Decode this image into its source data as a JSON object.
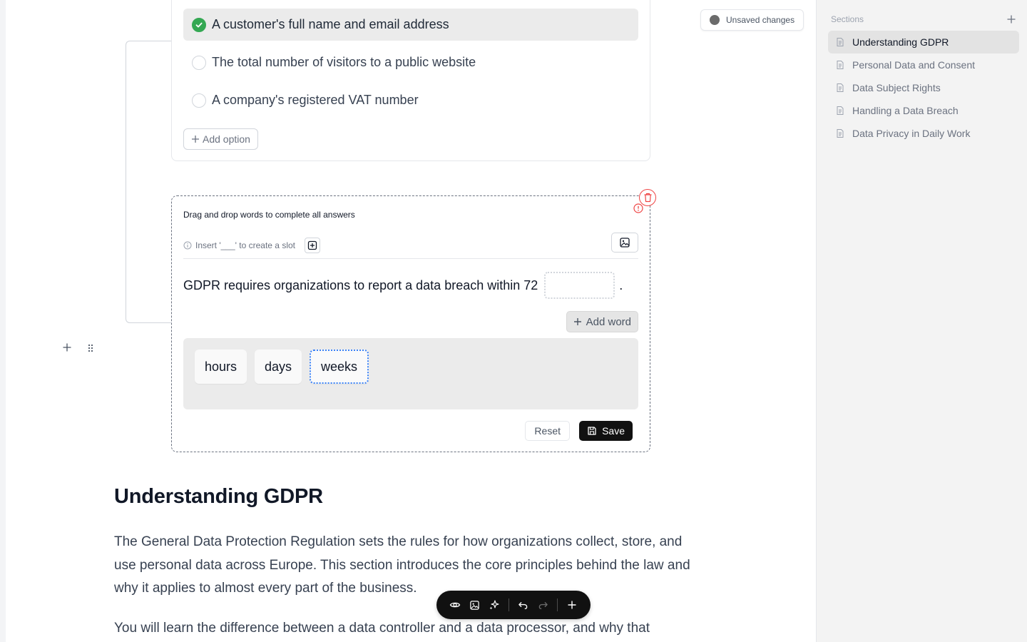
{
  "multiple_choice": {
    "options": [
      {
        "label": "A customer's full name and email address",
        "selected": true
      },
      {
        "label": "The total number of visitors to a public website",
        "selected": false
      },
      {
        "label": "A company's registered VAT number",
        "selected": false
      }
    ],
    "add_option_label": "Add option"
  },
  "drag_drop": {
    "title": "Drag and drop words to complete all answers",
    "hint": "Insert '___' to create a slot",
    "sentence_text": "GDPR requires organizations to report a data breach within 72",
    "sentence_end": ".",
    "add_word_label": "Add word",
    "words": [
      "hours",
      "days",
      "weeks"
    ],
    "reset_label": "Reset",
    "save_label": "Save"
  },
  "status": {
    "unsaved_label": "Unsaved changes"
  },
  "content": {
    "title": "Understanding GDPR",
    "paragraph1": "The General Data Protection Regulation sets the rules for how organizations collect, store, and use personal data across Europe. This section introduces the core principles behind the law and why it applies to almost every part of the business.",
    "paragraph2": "You will learn the difference between a data controller and a data processor, and why that"
  },
  "sidebar": {
    "header": "Sections",
    "items": [
      {
        "label": "Understanding GDPR",
        "active": true
      },
      {
        "label": "Personal Data and Consent",
        "active": false
      },
      {
        "label": "Data Subject Rights",
        "active": false
      },
      {
        "label": "Handling a Data Breach",
        "active": false
      },
      {
        "label": "Data Privacy in Daily Work",
        "active": false
      }
    ]
  },
  "icons": {
    "check": "check-icon",
    "plus": "plus-icon",
    "info": "info-icon",
    "image": "image-icon",
    "trash": "trash-icon",
    "alert": "alert-circle-icon",
    "save": "save-icon",
    "drag": "drag-handle-icon",
    "eye": "eye-icon",
    "sparkles": "sparkles-icon",
    "undo": "undo-icon",
    "redo": "redo-icon",
    "document": "document-icon"
  },
  "colors": {
    "accent_green": "#34a853",
    "error_red": "#ef4444",
    "focus_blue": "#3b82f6",
    "toolbar_dark": "#111111"
  }
}
